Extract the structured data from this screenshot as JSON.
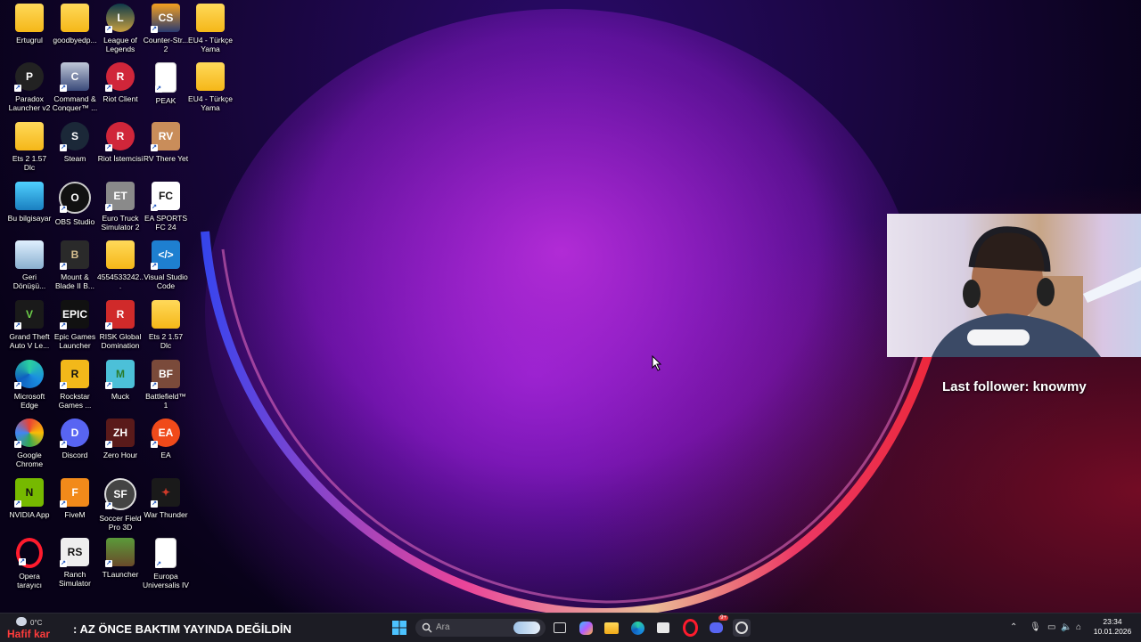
{
  "desktop_icons": [
    {
      "label": "Ertugrul"
    },
    {
      "label": "goodbyedp..."
    },
    {
      "label": "League of Legends"
    },
    {
      "label": "Counter-Str... 2"
    },
    {
      "label": "EU4 - Türkçe Yama"
    },
    {
      "label": "Paradox Launcher v2"
    },
    {
      "label": "Command & Conquer™ ..."
    },
    {
      "label": "Riot Client"
    },
    {
      "label": "PEAK"
    },
    {
      "label": "EU4 - Türkçe Yama"
    },
    {
      "label": "Ets 2 1.57 Dlc"
    },
    {
      "label": "Steam"
    },
    {
      "label": "Riot İstemcisi"
    },
    {
      "label": "RV There Yet"
    },
    {
      "label": "Bu bilgisayar"
    },
    {
      "label": "OBS Studio"
    },
    {
      "label": "Euro Truck Simulator 2"
    },
    {
      "label": "EA SPORTS FC 24"
    },
    {
      "label": "Geri Dönüşü..."
    },
    {
      "label": "Mount & Blade II B..."
    },
    {
      "label": "4554533242..."
    },
    {
      "label": "Visual Studio Code"
    },
    {
      "label": "Grand Theft Auto V Le..."
    },
    {
      "label": "Epic Games Launcher"
    },
    {
      "label": "RISK Global Domination"
    },
    {
      "label": "Ets 2 1.57 Dlc"
    },
    {
      "label": "Microsoft Edge"
    },
    {
      "label": "Rockstar Games ..."
    },
    {
      "label": "Muck"
    },
    {
      "label": "Battlefield™ 1"
    },
    {
      "label": "Google Chrome"
    },
    {
      "label": "Discord"
    },
    {
      "label": "Zero Hour"
    },
    {
      "label": "EA"
    },
    {
      "label": "NVIDIA App"
    },
    {
      "label": "FiveM"
    },
    {
      "label": "Soccer Field Pro 3D"
    },
    {
      "label": "War Thunder"
    },
    {
      "label": "Opera tarayıcı"
    },
    {
      "label": "Ranch Simulator"
    },
    {
      "label": "TLauncher"
    },
    {
      "label": "Europa Universalis IV"
    }
  ],
  "overlay": {
    "follower_text": "Last follower: knowmy"
  },
  "taskbar": {
    "weather_temp": "0°C",
    "weather_status": "Hafif kar",
    "ticker": ": AZ ÖNCE BAKTIM YAYINDA DEĞİLDİN",
    "search_placeholder": "Ara",
    "time": "23:34",
    "date": "10.01.2026",
    "discord_badge": "9+"
  }
}
